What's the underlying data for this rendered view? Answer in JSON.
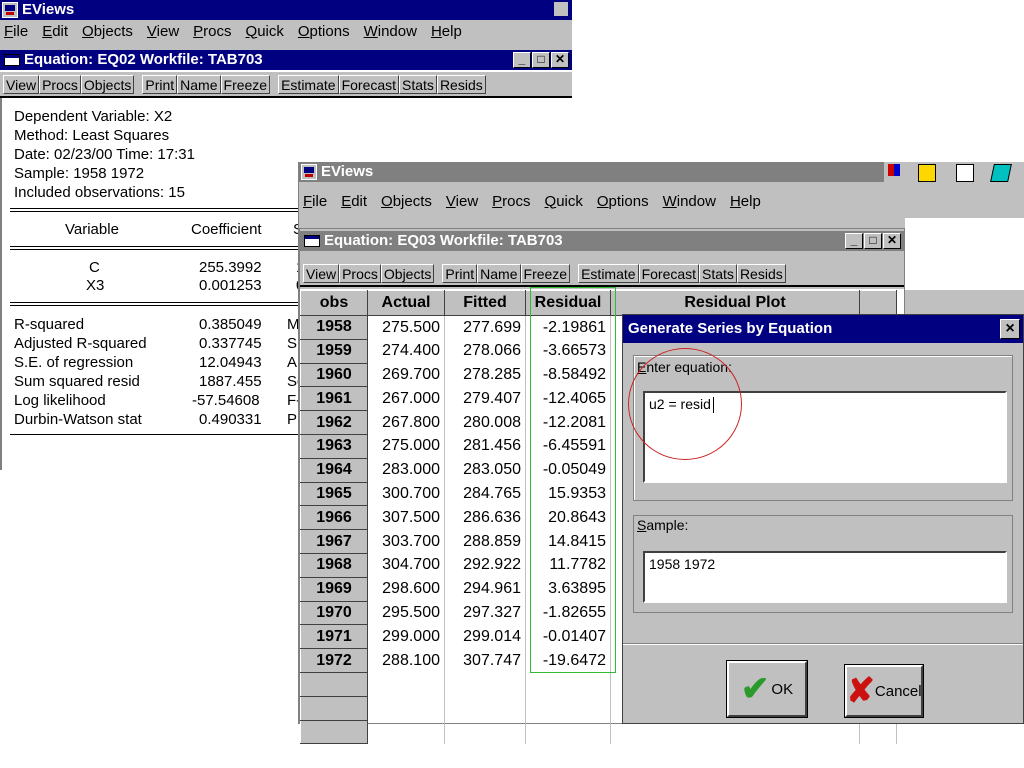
{
  "back_app": {
    "title": "EViews",
    "menu": [
      "File",
      "Edit",
      "Objects",
      "View",
      "Procs",
      "Quick",
      "Options",
      "Window",
      "Help"
    ]
  },
  "eq02": {
    "title": "Equation: EQ02   Workfile: TAB703",
    "toolbar": [
      "View",
      "Procs",
      "Objects",
      "Print",
      "Name",
      "Freeze",
      "Estimate",
      "Forecast",
      "Stats",
      "Resids"
    ],
    "header": [
      "Dependent Variable: X2",
      "Method: Least Squares",
      "Date: 02/23/00   Time: 17:31",
      "Sample: 1958 1972",
      "Included observations: 15"
    ],
    "col_variable": "Variable",
    "col_coefficient": "Coefficient",
    "col_trunc": "S",
    "vars": [
      {
        "name": "C",
        "coef": "255.3992",
        "trunc": "1"
      },
      {
        "name": "X3",
        "coef": "0.001253",
        "trunc": "0"
      }
    ],
    "stats": [
      {
        "label": "R-squared",
        "value": "0.385049",
        "trunc": "M"
      },
      {
        "label": "Adjusted R-squared",
        "value": "0.337745",
        "trunc": "S."
      },
      {
        "label": "S.E. of regression",
        "value": "12.04943",
        "trunc": "Al"
      },
      {
        "label": "Sum squared resid",
        "value": "1887.455",
        "trunc": "Sc"
      },
      {
        "label": "Log likelihood",
        "value": "-57.54608",
        "trunc": "F-"
      },
      {
        "label": "Durbin-Watson stat",
        "value": "0.490331",
        "trunc": "Pr"
      }
    ]
  },
  "front_app": {
    "title": "EViews",
    "menu": [
      "File",
      "Edit",
      "Objects",
      "View",
      "Procs",
      "Quick",
      "Options",
      "Window",
      "Help"
    ]
  },
  "eq03": {
    "title": "Equation: EQ03   Workfile: TAB703",
    "toolbar": [
      "View",
      "Procs",
      "Objects",
      "Print",
      "Name",
      "Freeze",
      "Estimate",
      "Forecast",
      "Stats",
      "Resids"
    ],
    "columns": [
      "obs",
      "Actual",
      "Fitted",
      "Residual",
      "Residual Plot"
    ],
    "rows": [
      [
        "1958",
        "275.500",
        "277.699",
        "-2.19861"
      ],
      [
        "1959",
        "274.400",
        "278.066",
        "-3.66573"
      ],
      [
        "1960",
        "269.700",
        "278.285",
        "-8.58492"
      ],
      [
        "1961",
        "267.000",
        "279.407",
        "-12.4065"
      ],
      [
        "1962",
        "267.800",
        "280.008",
        "-12.2081"
      ],
      [
        "1963",
        "275.000",
        "281.456",
        "-6.45591"
      ],
      [
        "1964",
        "283.000",
        "283.050",
        "-0.05049"
      ],
      [
        "1965",
        "300.700",
        "284.765",
        "15.9353"
      ],
      [
        "1966",
        "307.500",
        "286.636",
        "20.8643"
      ],
      [
        "1967",
        "303.700",
        "288.859",
        "14.8415"
      ],
      [
        "1968",
        "304.700",
        "292.922",
        "11.7782"
      ],
      [
        "1969",
        "298.600",
        "294.961",
        "3.63895"
      ],
      [
        "1970",
        "295.500",
        "297.327",
        "-1.82655"
      ],
      [
        "1971",
        "299.000",
        "299.014",
        "-0.01407"
      ],
      [
        "1972",
        "288.100",
        "307.747",
        "-19.6472"
      ]
    ]
  },
  "dialog": {
    "title": "Generate Series by Equation",
    "close": "×",
    "equation_label": "Enter equation:",
    "equation_value": "u2 = resid",
    "sample_label": "Sample:",
    "sample_value": "1958 1972",
    "ok_label": "OK",
    "cancel_label": "Cancel"
  },
  "colors": {
    "title_active": "#000080",
    "title_inactive": "#808080",
    "chrome": "#c0c0c0",
    "highlight_green": "#33bb33",
    "annotation_red": "#cc2222"
  }
}
